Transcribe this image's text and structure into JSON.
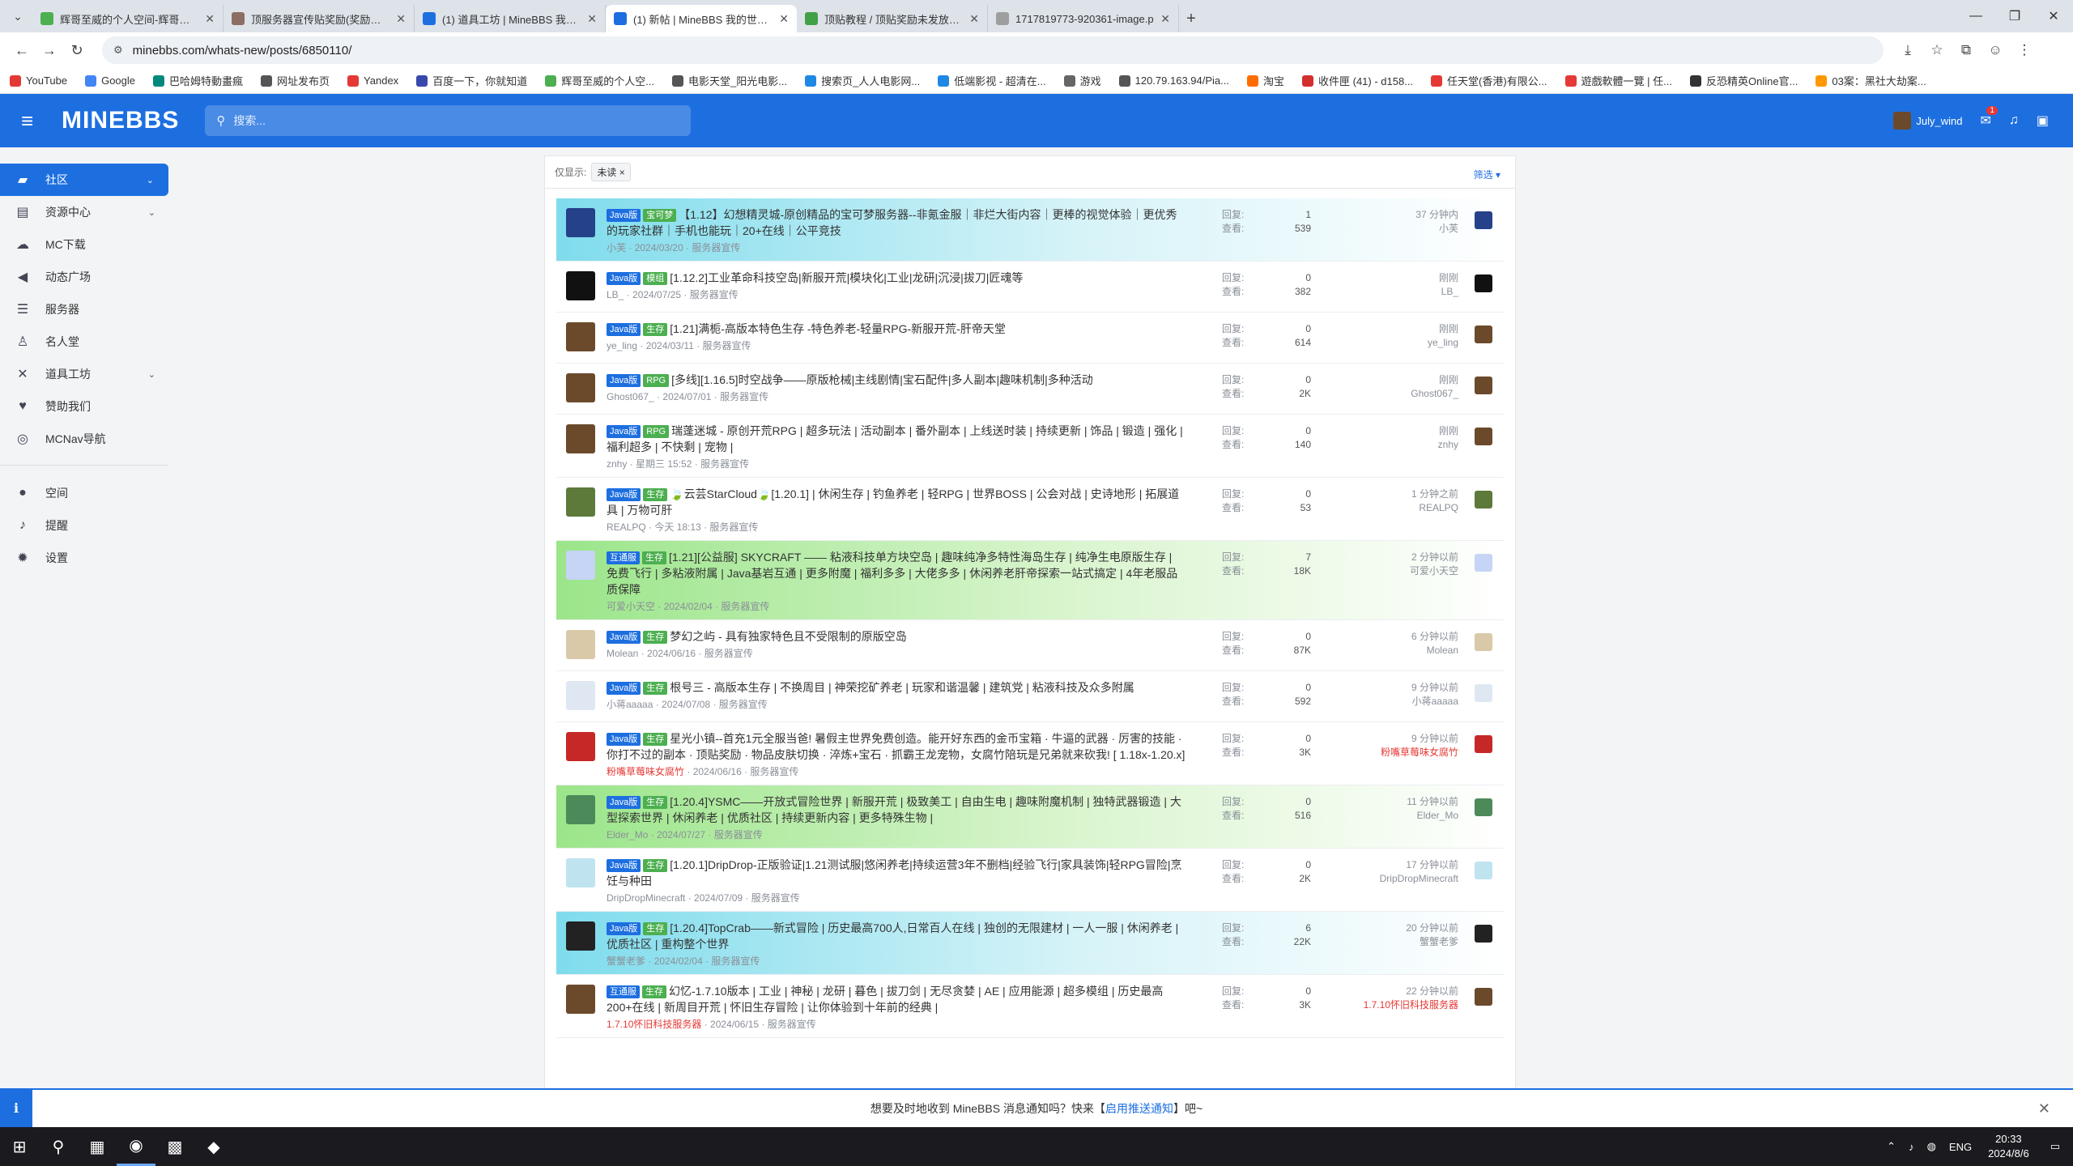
{
  "browser": {
    "tabs": [
      {
        "title": "辉哥至威的个人空间-辉哥至威",
        "color": "#4caf50",
        "active": false
      },
      {
        "title": "顶服务器宣传贴奖励(奖励天空",
        "color": "#8d6e63",
        "active": false
      },
      {
        "title": "(1) 道具工坊 | MineBBS 我的世",
        "color": "#1d6fe0",
        "active": false
      },
      {
        "title": "(1) 新帖 | MineBBS 我的世界中",
        "color": "#1d6fe0",
        "active": true
      },
      {
        "title": "顶贴教程 / 顶贴奖励未发放补领",
        "color": "#43a047",
        "active": false
      },
      {
        "title": "1717819773-920361-image.p",
        "color": "#9e9e9e",
        "active": false
      }
    ],
    "url": "minebbs.com/whats-new/posts/6850110/",
    "bookmarks": [
      {
        "label": "YouTube",
        "color": "#e53935"
      },
      {
        "label": "Google",
        "color": "#4285f4"
      },
      {
        "label": "巴哈姆特動畫瘋",
        "color": "#00897b"
      },
      {
        "label": "网址发布页",
        "color": "#555555"
      },
      {
        "label": "Yandex",
        "color": "#e53935"
      },
      {
        "label": "百度一下，你就知道",
        "color": "#3949ab"
      },
      {
        "label": "辉哥至威的个人空...",
        "color": "#4caf50"
      },
      {
        "label": "电影天堂_阳光电影...",
        "color": "#555555"
      },
      {
        "label": "搜索页_人人电影网...",
        "color": "#1e88e5"
      },
      {
        "label": "低端影视 - 超清在...",
        "color": "#1e88e5"
      },
      {
        "label": "游戏",
        "color": "#666666"
      },
      {
        "label": "120.79.163.94/Pia...",
        "color": "#555555"
      },
      {
        "label": "淘宝",
        "color": "#ff6d00"
      },
      {
        "label": "收件匣 (41) - d158...",
        "color": "#d32f2f"
      },
      {
        "label": "任天堂(香港)有限公...",
        "color": "#e53935"
      },
      {
        "label": "遊戲軟體一覽 | 任...",
        "color": "#e53935"
      },
      {
        "label": "反恐精英Online官...",
        "color": "#333333"
      },
      {
        "label": "03案：黑社大劫案...",
        "color": "#ff9800"
      }
    ]
  },
  "site": {
    "logo": "MINEBBS",
    "search_placeholder": "搜索...",
    "username": "July_wind",
    "msg_badge": "1"
  },
  "sidebar": {
    "items": [
      {
        "label": "社区",
        "icon": "chat-icon",
        "glyph": "▰",
        "chev": true,
        "active": true
      },
      {
        "label": "资源中心",
        "icon": "resource-icon",
        "glyph": "▤",
        "chev": true
      },
      {
        "label": "MC下载",
        "icon": "cloud-download-icon",
        "glyph": "☁",
        "chev": false
      },
      {
        "label": "动态广场",
        "icon": "megaphone-icon",
        "glyph": "◀",
        "chev": false
      },
      {
        "label": "服务器",
        "icon": "server-icon",
        "glyph": "☰",
        "chev": false
      },
      {
        "label": "名人堂",
        "icon": "trophy-icon",
        "glyph": "♙",
        "chev": false
      },
      {
        "label": "道具工坊",
        "icon": "tools-icon",
        "glyph": "✕",
        "chev": true
      },
      {
        "label": "赞助我们",
        "icon": "donate-icon",
        "glyph": "♥",
        "chev": false
      },
      {
        "label": "MCNav导航",
        "icon": "compass-icon",
        "glyph": "◎",
        "chev": false
      }
    ],
    "items2": [
      {
        "label": "空间",
        "icon": "user-icon",
        "glyph": "●"
      },
      {
        "label": "提醒",
        "icon": "bell-icon",
        "glyph": "♪"
      },
      {
        "label": "设置",
        "icon": "gear-icon",
        "glyph": "✹"
      }
    ]
  },
  "filter": {
    "label": "仅显示:",
    "tag": "未读",
    "button": "筛选"
  },
  "labels": {
    "replies": "回复:",
    "views": "查看:"
  },
  "threads": [
    {
      "prefixes": [
        "Java版",
        "宝可梦"
      ],
      "title": "【1.12】幻想精灵城-原创精品的宝可梦服务器--非氪金服｜非烂大街内容｜更棒的视觉体验｜更优秀的玩家社群｜手机也能玩｜20+在线｜公平竞技",
      "author": "小芙",
      "date": "2024/03/20",
      "forum": "服务器宣传",
      "replies": "1",
      "views": "539",
      "last_time": "37 分钟内",
      "last_user": "小芙",
      "hl": "blue",
      "avatar": "#24418a"
    },
    {
      "prefixes": [
        "Java版",
        "模组"
      ],
      "title": "[1.12.2]工业革命科技空岛|新服开荒|模块化|工业|龙研|沉浸|拔刀|匠魂等",
      "author": "LB_",
      "date": "2024/07/25",
      "forum": "服务器宣传",
      "replies": "0",
      "views": "382",
      "last_time": "刚刚",
      "last_user": "LB_",
      "hl": "",
      "avatar": "#111111"
    },
    {
      "prefixes": [
        "Java版",
        "生存"
      ],
      "title": "[1.21]满栀-高版本特色生存 -特色养老-轻量RPG-新服开荒-肝帝天堂",
      "author": "ye_ling",
      "date": "2024/03/11",
      "forum": "服务器宣传",
      "replies": "0",
      "views": "614",
      "last_time": "刚刚",
      "last_user": "ye_ling",
      "hl": "",
      "avatar": "#6b4a2b"
    },
    {
      "prefixes": [
        "Java版",
        "RPG"
      ],
      "title": "[多线][1.16.5]时空战争——原版枪械|主线剧情|宝石配件|多人副本|趣味机制|多种活动",
      "author": "Ghost067_",
      "date": "2024/07/01",
      "forum": "服务器宣传",
      "replies": "0",
      "views": "2K",
      "last_time": "刚刚",
      "last_user": "Ghost067_",
      "hl": "",
      "avatar": "#6b4a2b"
    },
    {
      "prefixes": [
        "Java版",
        "RPG"
      ],
      "title": "瑞蓬迷城 - 原创开荒RPG | 超多玩法 | 活动副本 | 番外副本 | 上线送时装 | 持续更新 | 饰品 | 锻造 | 强化 | 福利超多 | 不快剩 | 宠物 |",
      "author": "znhy",
      "date": "星期三 15:52",
      "forum": "服务器宣传",
      "replies": "0",
      "views": "140",
      "last_time": "刚刚",
      "last_user": "znhy",
      "hl": "",
      "avatar": "#6b4a2b"
    },
    {
      "prefixes": [
        "Java版",
        "生存"
      ],
      "title": "🍃云芸StarCloud🍃[1.20.1] | 休闲生存 | 钓鱼养老 | 轻RPG | 世界BOSS | 公会对战 | 史诗地形 | 拓展道具 | 万物可肝",
      "author": "REALPQ",
      "date": "今天 18:13",
      "forum": "服务器宣传",
      "replies": "0",
      "views": "53",
      "last_time": "1 分钟之前",
      "last_user": "REALPQ",
      "hl": "",
      "avatar": "#5d7a3a"
    },
    {
      "prefixes": [
        "互通服",
        "生存"
      ],
      "title": "[1.21][公益服] SKYCRAFT —— 粘液科技单方块空岛 | 趣味纯净多特性海岛生存 | 纯净生电原版生存 | 免费飞行 | 多粘液附属 | Java基岩互通 | 更多附魔 | 福利多多 | 大佬多多 | 休闲养老肝帝探索一站式搞定 | 4年老服品质保障",
      "author": "可爱小天空",
      "date": "2024/02/04",
      "forum": "服务器宣传",
      "replies": "7",
      "views": "18K",
      "last_time": "2 分钟以前",
      "last_user": "可爱小天空",
      "hl": "green",
      "avatar": "#c6d4f5"
    },
    {
      "prefixes": [
        "Java版",
        "生存"
      ],
      "title": "梦幻之屿 - 具有独家特色且不受限制的原版空岛",
      "author": "Molean",
      "date": "2024/06/16",
      "forum": "服务器宣传",
      "replies": "0",
      "views": "87K",
      "last_time": "6 分钟以前",
      "last_user": "Molean",
      "hl": "",
      "avatar": "#d9c9a8"
    },
    {
      "prefixes": [
        "Java版",
        "生存"
      ],
      "title": "根号三 - 高版本生存 | 不换周目 | 神荣挖矿养老 | 玩家和谐温馨 | 建筑党 | 粘液科技及众多附属",
      "author": "小蒋aaaaa",
      "date": "2024/07/08",
      "forum": "服务器宣传",
      "replies": "0",
      "views": "592",
      "last_time": "9 分钟以前",
      "last_user": "小蒋aaaaa",
      "hl": "",
      "avatar": "#dfe7f2"
    },
    {
      "prefixes": [
        "Java版",
        "生存"
      ],
      "title": "星光小镇--首充1元全服当爸! 暑假主世界免费创造。能开好东西的金币宝箱 · 牛逼的武器 · 厉害的技能 · 你打不过的副本 · 顶贴奖励 · 物品皮肤切换 · 淬炼+宝石 · 抓霸王龙宠物，女腐竹陪玩是兄弟就来砍我! [ 1.18x-1.20.x]",
      "author": "粉嘴草莓味女腐竹",
      "date": "2024/06/16",
      "forum": "服务器宣传",
      "replies": "0",
      "views": "3K",
      "last_time": "9 分钟以前",
      "last_user": "粉嘴草莓味女腐竹",
      "hl": "",
      "avatar": "#c62828",
      "red": true
    },
    {
      "prefixes": [
        "Java版",
        "生存"
      ],
      "title": "[1.20.4]YSMC——开放式冒险世界 | 新服开荒 | 极致美工 | 自由生电 | 趣味附魔机制 | 独特武器锻造 | 大型探索世界 | 休闲养老 | 优质社区 | 持续更新内容 | 更多特殊生物 |",
      "author": "Elder_Mo",
      "date": "2024/07/27",
      "forum": "服务器宣传",
      "replies": "0",
      "views": "516",
      "last_time": "11 分钟以前",
      "last_user": "Elder_Mo",
      "hl": "green",
      "avatar": "#4d8a5a"
    },
    {
      "prefixes": [
        "Java版",
        "生存"
      ],
      "title": "[1.20.1]DripDrop-正版验证|1.21测试服|悠闲养老|持续运营3年不删档|经验飞行|家具装饰|轻RPG冒险|烹饪与种田",
      "author": "DripDropMinecraft",
      "date": "2024/07/09",
      "forum": "服务器宣传",
      "replies": "0",
      "views": "2K",
      "last_time": "17 分钟以前",
      "last_user": "DripDropMinecraft",
      "hl": "",
      "avatar": "#bfe4f0"
    },
    {
      "prefixes": [
        "Java版",
        "生存"
      ],
      "title": "[1.20.4]TopCrab——新式冒险 | 历史最高700人,日常百人在线 | 独创的无限建材 | 一人一服 | 休闲养老 | 优质社区 | 重构整个世界",
      "author": "蟹蟹老爹",
      "date": "2024/02/04",
      "forum": "服务器宣传",
      "replies": "6",
      "views": "22K",
      "last_time": "20 分钟以前",
      "last_user": "蟹蟹老爹",
      "hl": "blue",
      "avatar": "#222222"
    },
    {
      "prefixes": [
        "互通服",
        "生存"
      ],
      "title": "幻忆-1.7.10版本 | 工业 | 神秘 | 龙研 | 暮色 | 拔刀剑 | 无尽贪婪 | AE | 应用能源 | 超多模组 | 历史最高200+在线 | 新周目开荒 | 怀旧生存冒险 | 让你体验到十年前的经典 |",
      "author": "1.7.10怀旧科技服务器",
      "date": "2024/06/15",
      "forum": "服务器宣传",
      "replies": "0",
      "views": "3K",
      "last_time": "22 分钟以前",
      "last_user": "1.7.10怀旧科技服务器",
      "hl": "",
      "avatar": "#6b4a2b",
      "red": true
    }
  ],
  "notify": {
    "pre": "想要及时地收到 MineBBS 消息通知吗？快来【",
    "link": "启用推送通知",
    "post": "】吧~"
  },
  "taskbar": {
    "lang": "ENG",
    "time": "20:33",
    "date": "2024/8/6"
  }
}
